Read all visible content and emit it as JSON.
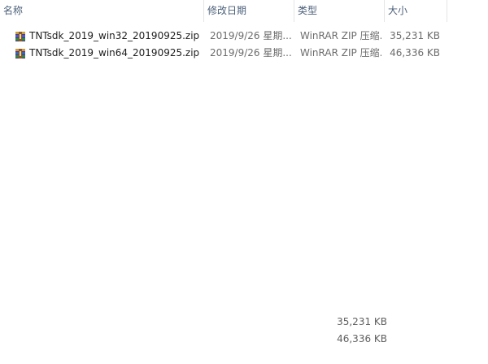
{
  "columns": {
    "name": "名称",
    "date": "修改日期",
    "type": "类型",
    "size": "大小"
  },
  "sort_indicator": "up-caret",
  "files": [
    {
      "icon": "winrar-zip-icon",
      "name": "TNTsdk_2019_win32_20190925.zip",
      "date": "2019/9/26 星期...",
      "type": "WinRAR ZIP 压缩...",
      "size": "35,231 KB"
    },
    {
      "icon": "winrar-zip-icon",
      "name": "TNTsdk_2019_win64_20190925.zip",
      "date": "2019/9/26 星期...",
      "type": "WinRAR ZIP 压缩...",
      "size": "46,336 KB"
    }
  ],
  "summary_sizes": [
    "35,231 KB",
    "46,336 KB"
  ],
  "colors": {
    "header_text": "#4c607a",
    "text": "#1e1e1e",
    "secondary_text": "#6d6d6d"
  }
}
